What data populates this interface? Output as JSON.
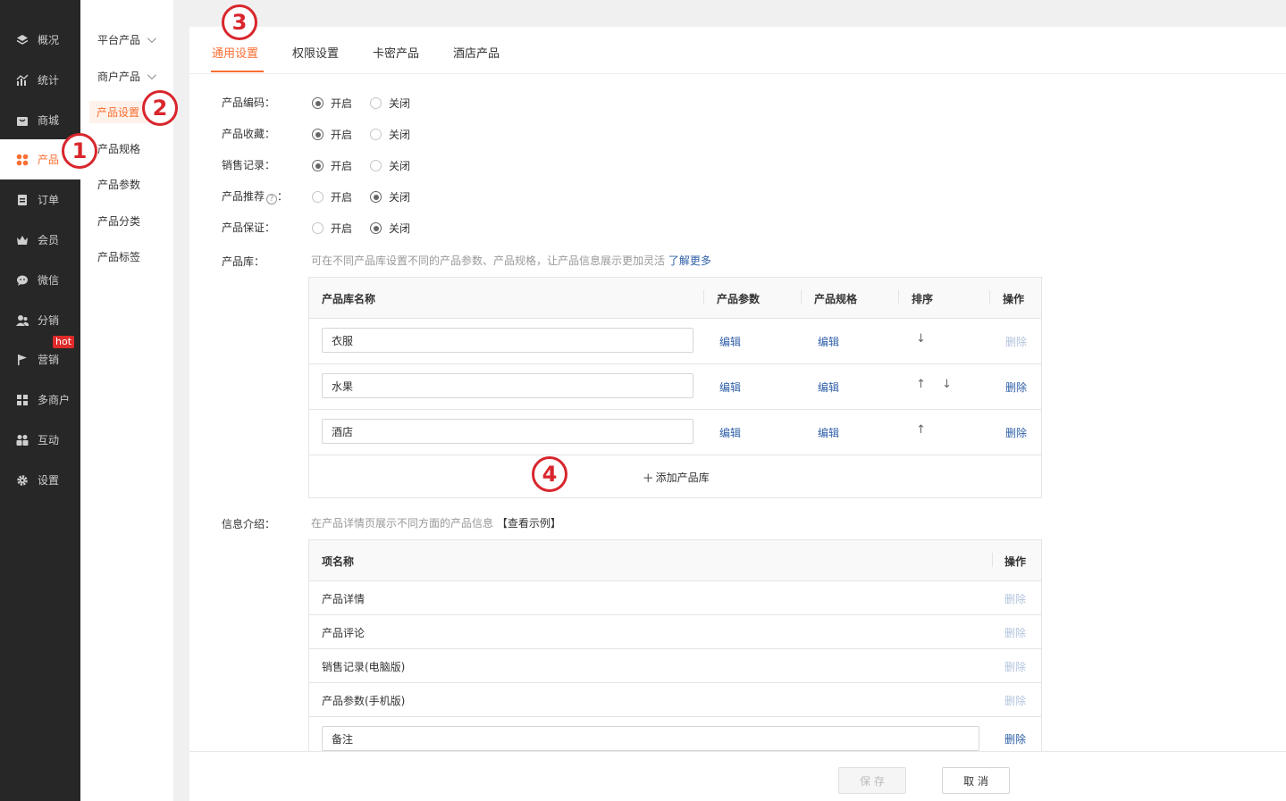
{
  "main_nav": [
    {
      "label": "概况",
      "icon": "layers-icon"
    },
    {
      "label": "统计",
      "icon": "chart-icon"
    },
    {
      "label": "商城",
      "icon": "store-icon"
    },
    {
      "label": "产品",
      "icon": "product-grid-icon",
      "active": true
    },
    {
      "label": "订单",
      "icon": "order-icon"
    },
    {
      "label": "会员",
      "icon": "crown-icon"
    },
    {
      "label": "微信",
      "icon": "wechat-icon"
    },
    {
      "label": "分销",
      "icon": "distribution-icon"
    },
    {
      "label": "营销",
      "icon": "flag-icon",
      "badge": "hot"
    },
    {
      "label": "多商户",
      "icon": "merchant-icon"
    },
    {
      "label": "互动",
      "icon": "interaction-icon"
    },
    {
      "label": "设置",
      "icon": "gear-icon"
    }
  ],
  "sub_nav": {
    "platform_products": "平台产品",
    "merchant_products": "商户产品",
    "product_settings": "产品设置",
    "product_specs": "产品规格",
    "product_params": "产品参数",
    "product_category": "产品分类",
    "product_tags": "产品标签"
  },
  "tabs": [
    "通用设置",
    "权限设置",
    "卡密产品",
    "酒店产品"
  ],
  "options": {
    "on": "开启",
    "off": "关闭",
    "items": [
      {
        "label": "产品编码：",
        "value": "on"
      },
      {
        "label": "产品收藏：",
        "value": "on"
      },
      {
        "label": "销售记录：",
        "value": "on"
      },
      {
        "label": "产品推荐",
        "value": "off",
        "help": true
      },
      {
        "label": "产品保证：",
        "value": "off"
      }
    ]
  },
  "library": {
    "label": "产品库：",
    "hint": "可在不同产品库设置不同的产品参数、产品规格，让产品信息展示更加灵活",
    "learn_more": "了解更多",
    "headers": {
      "name": "产品库名称",
      "params": "产品参数",
      "specs": "产品规格",
      "sort": "排序",
      "action": "操作"
    },
    "edit": "编辑",
    "delete": "删除",
    "rows": [
      {
        "name": "衣服",
        "up": false,
        "down": true,
        "delete_enabled": false
      },
      {
        "name": "水果",
        "up": true,
        "down": true,
        "delete_enabled": true
      },
      {
        "name": "酒店",
        "up": true,
        "down": false,
        "delete_enabled": true
      }
    ],
    "add": "添加产品库"
  },
  "info": {
    "label": "信息介绍：",
    "hint": "在产品详情页展示不同方面的产品信息",
    "example": "【查看示例】",
    "headers": {
      "name": "项名称",
      "action": "操作"
    },
    "delete": "删除",
    "rows": [
      "产品详情",
      "产品评论",
      "销售记录(电脑版)",
      "产品参数(手机版)"
    ],
    "input_row": "备注"
  },
  "footer": {
    "save": "保 存",
    "cancel": "取 消"
  },
  "markers": [
    "1",
    "2",
    "3",
    "4"
  ],
  "colors": {
    "accent": "#fa6e31",
    "link": "#2f5fa8",
    "sidebar": "#272727",
    "marker": "#d8262c"
  }
}
